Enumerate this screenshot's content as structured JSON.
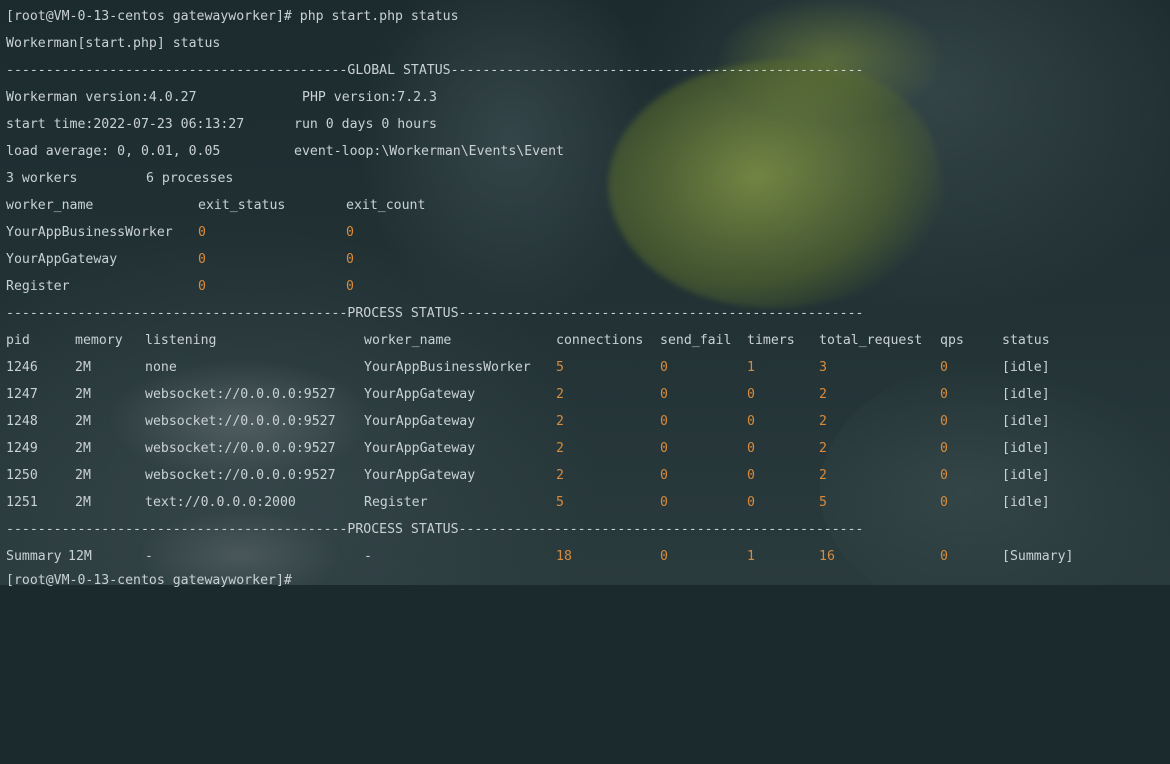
{
  "terminal": {
    "prompt_cmd": "[root@VM-0-13-centos gatewayworker]# php start.php status",
    "status_line": "Workerman[start.php] status",
    "global_sep": "-------------------------------------------GLOBAL STATUS----------------------------------------------------",
    "global": {
      "version": "Workerman version:4.0.27",
      "php": "PHP version:7.2.3",
      "start_time": "start time:2022-07-23 06:13:27",
      "run": "run 0 days 0 hours",
      "load": "load average: 0, 0.01, 0.05",
      "event_loop": "event-loop:\\Workerman\\Events\\Event",
      "workers": "3 workers",
      "processes": "6 processes"
    },
    "workers_header": [
      "worker_name",
      "exit_status",
      "exit_count"
    ],
    "workers_rows": [
      [
        "YourAppBusinessWorker",
        "0",
        "0"
      ],
      [
        "YourAppGateway",
        "0",
        "0"
      ],
      [
        "Register",
        "0",
        "0"
      ]
    ],
    "process_sep": "-------------------------------------------PROCESS STATUS---------------------------------------------------",
    "process_header": [
      "pid",
      "memory",
      "listening",
      "worker_name",
      "connections",
      "send_fail",
      "timers",
      "total_request",
      "qps",
      "status"
    ],
    "process_rows": [
      [
        "1246",
        "2M",
        "none",
        "YourAppBusinessWorker",
        "5",
        "0",
        "1",
        "3",
        "0",
        "[idle]"
      ],
      [
        "1247",
        "2M",
        "websocket://0.0.0.0:9527",
        "YourAppGateway",
        "2",
        "0",
        "0",
        "2",
        "0",
        "[idle]"
      ],
      [
        "1248",
        "2M",
        "websocket://0.0.0.0:9527",
        "YourAppGateway",
        "2",
        "0",
        "0",
        "2",
        "0",
        "[idle]"
      ],
      [
        "1249",
        "2M",
        "websocket://0.0.0.0:9527",
        "YourAppGateway",
        "2",
        "0",
        "0",
        "2",
        "0",
        "[idle]"
      ],
      [
        "1250",
        "2M",
        "websocket://0.0.0.0:9527",
        "YourAppGateway",
        "2",
        "0",
        "0",
        "2",
        "0",
        "[idle]"
      ],
      [
        "1251",
        "2M",
        "text://0.0.0.0:2000",
        "Register",
        "5",
        "0",
        "0",
        "5",
        "0",
        "[idle]"
      ]
    ],
    "summary_sep": "-------------------------------------------PROCESS STATUS---------------------------------------------------",
    "summary_row": [
      "Summary",
      "12M",
      "-",
      "-",
      "18",
      "0",
      "1",
      "16",
      "0",
      "[Summary]"
    ],
    "final_prompt": "[root@VM-0-13-centos gatewayworker]#"
  }
}
